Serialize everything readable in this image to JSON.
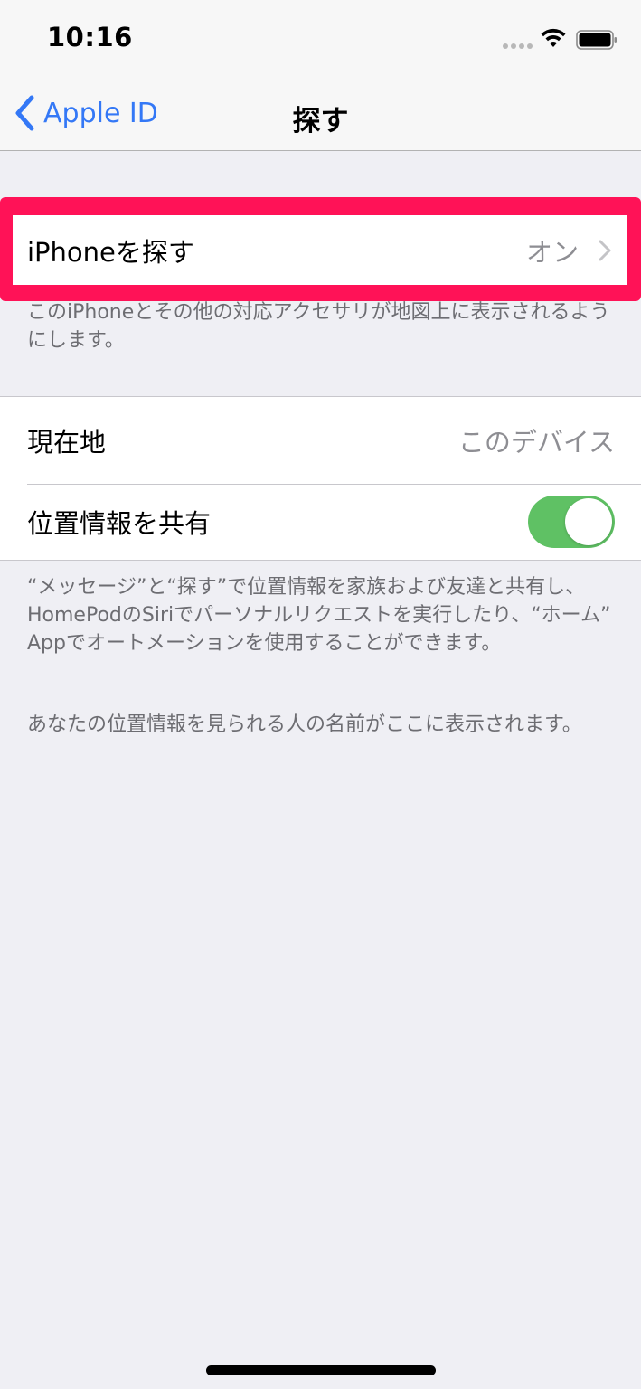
{
  "status_bar": {
    "time": "10:16",
    "signal_icon": "cellular-signal-icon",
    "wifi_icon": "wifi-icon",
    "battery_icon": "battery-icon"
  },
  "nav": {
    "back_label": "Apple ID",
    "back_icon": "chevron-left-icon",
    "title": "探す"
  },
  "find_iphone": {
    "label": "iPhoneを探す",
    "value": "オン",
    "icon": "chevron-right-icon",
    "highlight_color": "#ff1257",
    "footer": "このiPhoneとその他の対応アクセサリが地図上に表示されるようにします。"
  },
  "location_group": {
    "current_location": {
      "label": "現在地",
      "value": "このデバイス"
    },
    "share_location": {
      "label": "位置情報を共有",
      "toggle_on": true,
      "toggle_color": "#5fc164"
    },
    "footer": "“メッセージ”と“探す”で位置情報を家族および友達と共有し、HomePodのSiriでパーソナルリクエストを実行したり、“ホーム” Appでオートメーションを使用することができます。"
  },
  "viewers_note": "あなたの位置情報を見られる人の名前がここに表示されます。",
  "colors": {
    "accent": "#3478f6",
    "background": "#efeff4",
    "secondary_text": "#8e8e93"
  }
}
